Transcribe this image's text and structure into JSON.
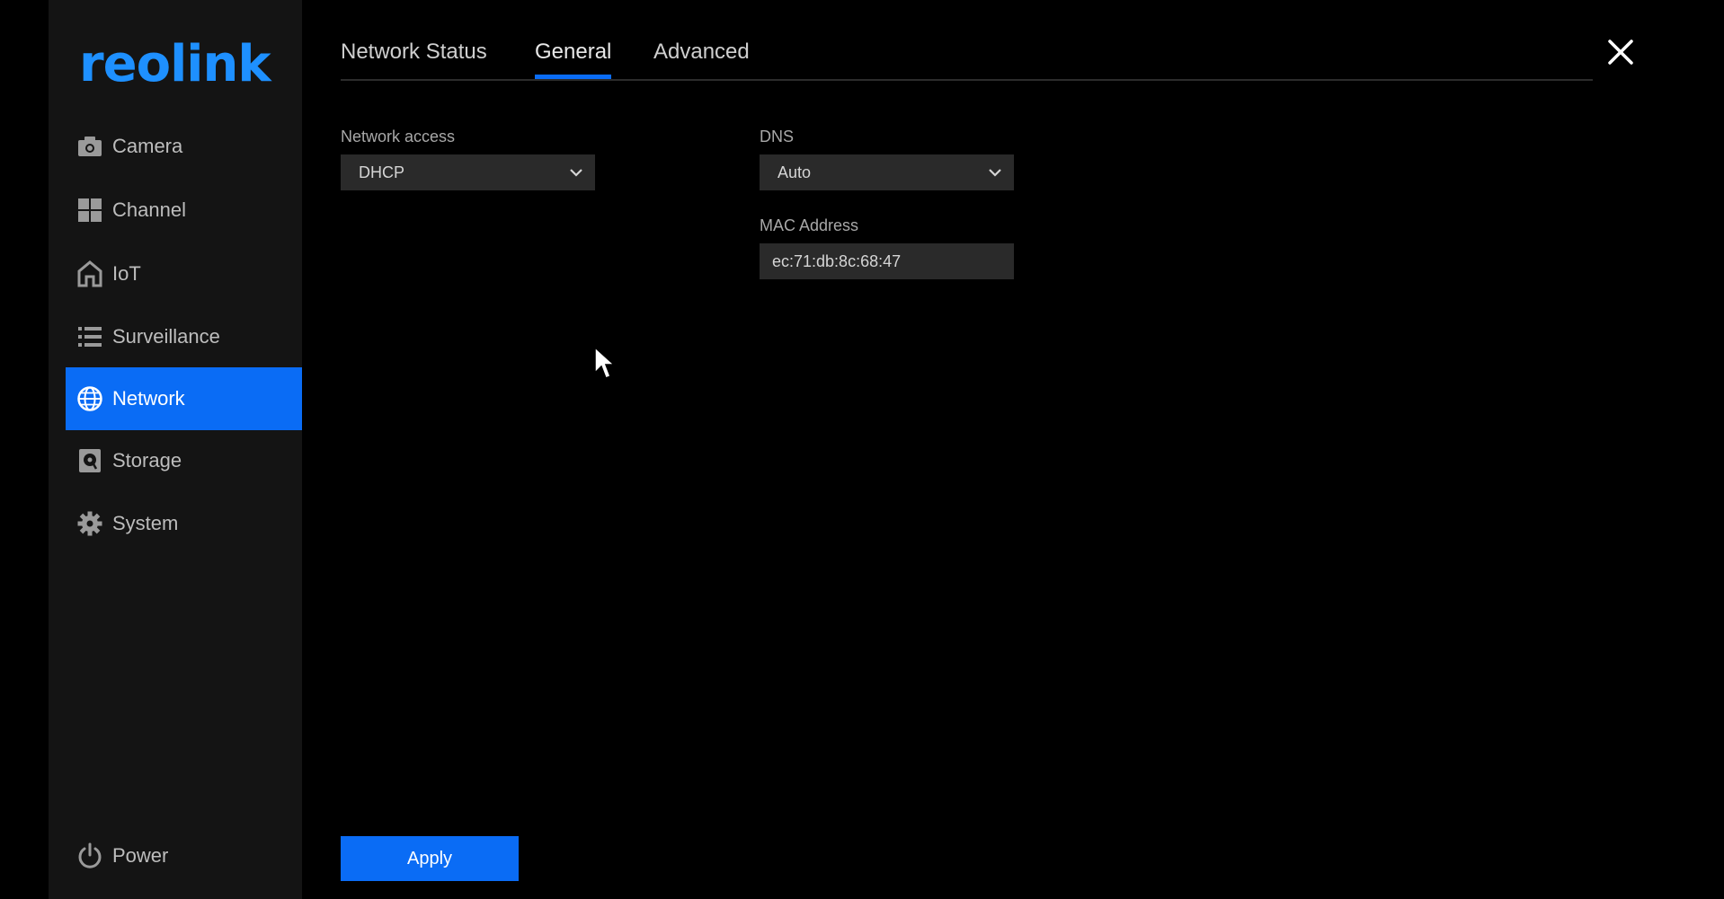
{
  "brand": {
    "logo_text": "reolink",
    "accent_color": "#0a6cf5"
  },
  "sidebar": {
    "items": [
      {
        "label": "Camera",
        "icon": "camera-icon",
        "active": false
      },
      {
        "label": "Channel",
        "icon": "grid-icon",
        "active": false
      },
      {
        "label": "IoT",
        "icon": "home-icon",
        "active": false
      },
      {
        "label": "Surveillance",
        "icon": "list-icon",
        "active": false
      },
      {
        "label": "Network",
        "icon": "globe-icon",
        "active": true
      },
      {
        "label": "Storage",
        "icon": "storage-icon",
        "active": false
      },
      {
        "label": "System",
        "icon": "gear-icon",
        "active": false
      }
    ],
    "power_label": "Power",
    "power_icon": "power-icon"
  },
  "tabs": [
    {
      "label": "Network Status",
      "active": false
    },
    {
      "label": "General",
      "active": true
    },
    {
      "label": "Advanced",
      "active": false
    }
  ],
  "form": {
    "network_access": {
      "label": "Network access",
      "value": "DHCP"
    },
    "dns": {
      "label": "DNS",
      "value": "Auto"
    },
    "mac_address": {
      "label": "MAC Address",
      "value": "ec:71:db:8c:68:47"
    }
  },
  "apply_label": "Apply",
  "close_icon": "close-icon"
}
